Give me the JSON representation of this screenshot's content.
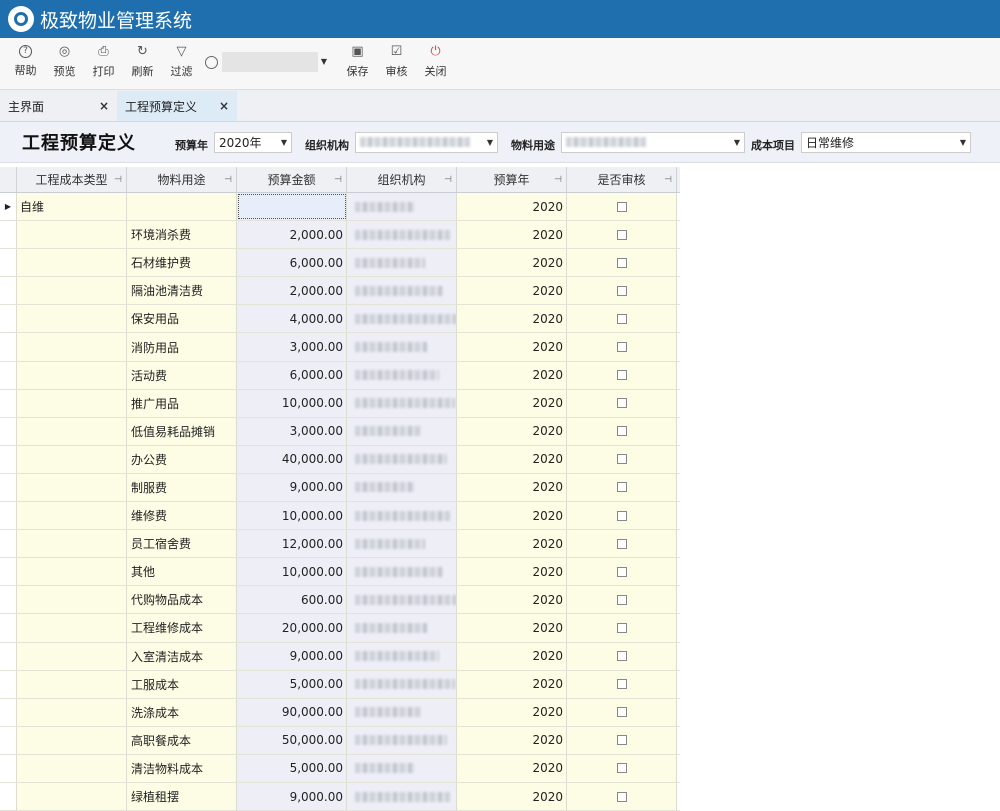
{
  "app": {
    "title": "极致物业管理系统"
  },
  "toolbar": {
    "help": "帮助",
    "preview": "预览",
    "print": "打印",
    "refresh": "刷新",
    "filter": "过滤",
    "save": "保存",
    "audit": "审核",
    "close": "关闭",
    "search_value": ""
  },
  "tabs": [
    {
      "label": "主界面",
      "close": "×"
    },
    {
      "label": "工程预算定义",
      "close": "×"
    }
  ],
  "filter": {
    "page_title": "工程预算定义",
    "year_label": "预算年",
    "year_value": "2020年",
    "org_label": "组织机构",
    "usage_label": "物料用途",
    "cost_label": "成本项目",
    "cost_value": "日常维修"
  },
  "table": {
    "headers": [
      "工程成本类型",
      "物料用途",
      "预算金额",
      "组织机构",
      "预算年",
      "是否审核"
    ],
    "rows": [
      {
        "type": "自维",
        "usage": "",
        "amount": "",
        "year": "2020"
      },
      {
        "type": "",
        "usage": "环境消杀费",
        "amount": "2,000.00",
        "year": "2020"
      },
      {
        "type": "",
        "usage": "石材维护费",
        "amount": "6,000.00",
        "year": "2020"
      },
      {
        "type": "",
        "usage": "隔油池清洁费",
        "amount": "2,000.00",
        "year": "2020"
      },
      {
        "type": "",
        "usage": "保安用品",
        "amount": "4,000.00",
        "year": "2020"
      },
      {
        "type": "",
        "usage": "消防用品",
        "amount": "3,000.00",
        "year": "2020"
      },
      {
        "type": "",
        "usage": "活动费",
        "amount": "6,000.00",
        "year": "2020"
      },
      {
        "type": "",
        "usage": "推广用品",
        "amount": "10,000.00",
        "year": "2020"
      },
      {
        "type": "",
        "usage": "低值易耗品摊销",
        "amount": "3,000.00",
        "year": "2020"
      },
      {
        "type": "",
        "usage": "办公费",
        "amount": "40,000.00",
        "year": "2020"
      },
      {
        "type": "",
        "usage": "制服费",
        "amount": "9,000.00",
        "year": "2020"
      },
      {
        "type": "",
        "usage": "维修费",
        "amount": "10,000.00",
        "year": "2020"
      },
      {
        "type": "",
        "usage": "员工宿舍费",
        "amount": "12,000.00",
        "year": "2020"
      },
      {
        "type": "",
        "usage": "其他",
        "amount": "10,000.00",
        "year": "2020"
      },
      {
        "type": "",
        "usage": "代购物品成本",
        "amount": "600.00",
        "year": "2020"
      },
      {
        "type": "",
        "usage": "工程维修成本",
        "amount": "20,000.00",
        "year": "2020"
      },
      {
        "type": "",
        "usage": "入室清洁成本",
        "amount": "9,000.00",
        "year": "2020"
      },
      {
        "type": "",
        "usage": "工服成本",
        "amount": "5,000.00",
        "year": "2020"
      },
      {
        "type": "",
        "usage": "洗涤成本",
        "amount": "90,000.00",
        "year": "2020"
      },
      {
        "type": "",
        "usage": "高职餐成本",
        "amount": "50,000.00",
        "year": "2020"
      },
      {
        "type": "",
        "usage": "清洁物料成本",
        "amount": "5,000.00",
        "year": "2020"
      },
      {
        "type": "",
        "usage": "绿植租摆",
        "amount": "9,000.00",
        "year": "2020"
      }
    ]
  }
}
